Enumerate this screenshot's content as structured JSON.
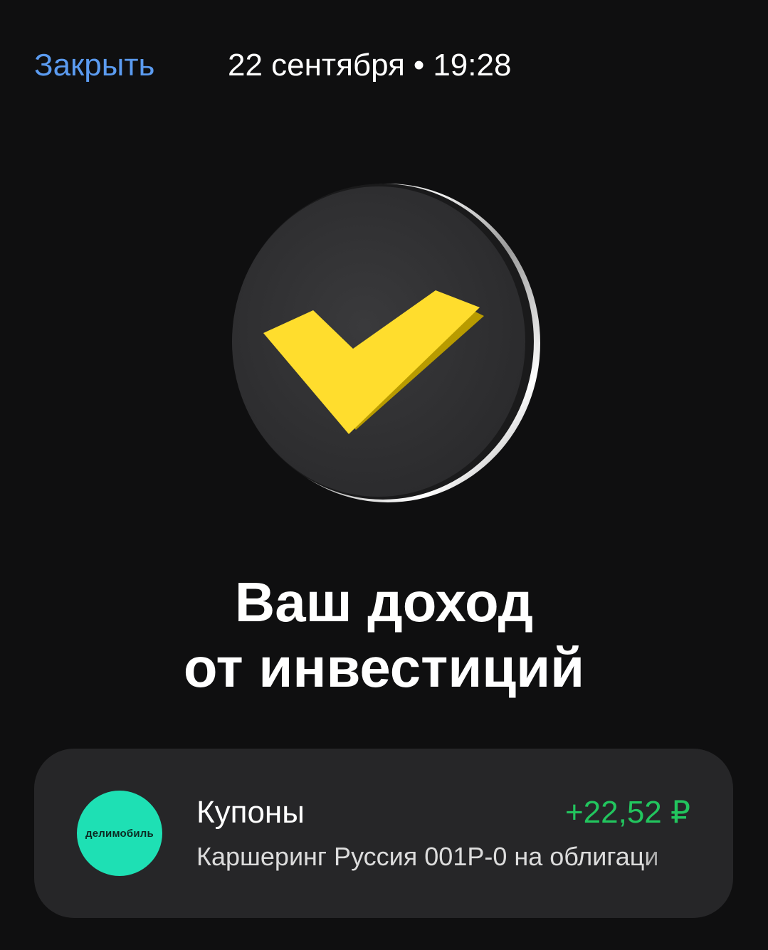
{
  "header": {
    "close_label": "Закрыть",
    "date": "22 сентября",
    "separator": "•",
    "time": "19:28"
  },
  "hero": {
    "icon": "checkmark-coin-icon",
    "title_line1": "Ваш доход",
    "title_line2": "от инвестиций"
  },
  "operation": {
    "logo_text": "делимобиль",
    "logo_color": "#1ee0b4",
    "title": "Купоны",
    "amount": "+22,52 ₽",
    "amount_color": "#22c55e",
    "subtitle": "Каршеринг Руссия 001P-0 на облигаци"
  },
  "colors": {
    "background": "#0f0f10",
    "accent_link": "#5b9bf0",
    "card_background": "#262628",
    "check_yellow": "#ffdd2d"
  }
}
